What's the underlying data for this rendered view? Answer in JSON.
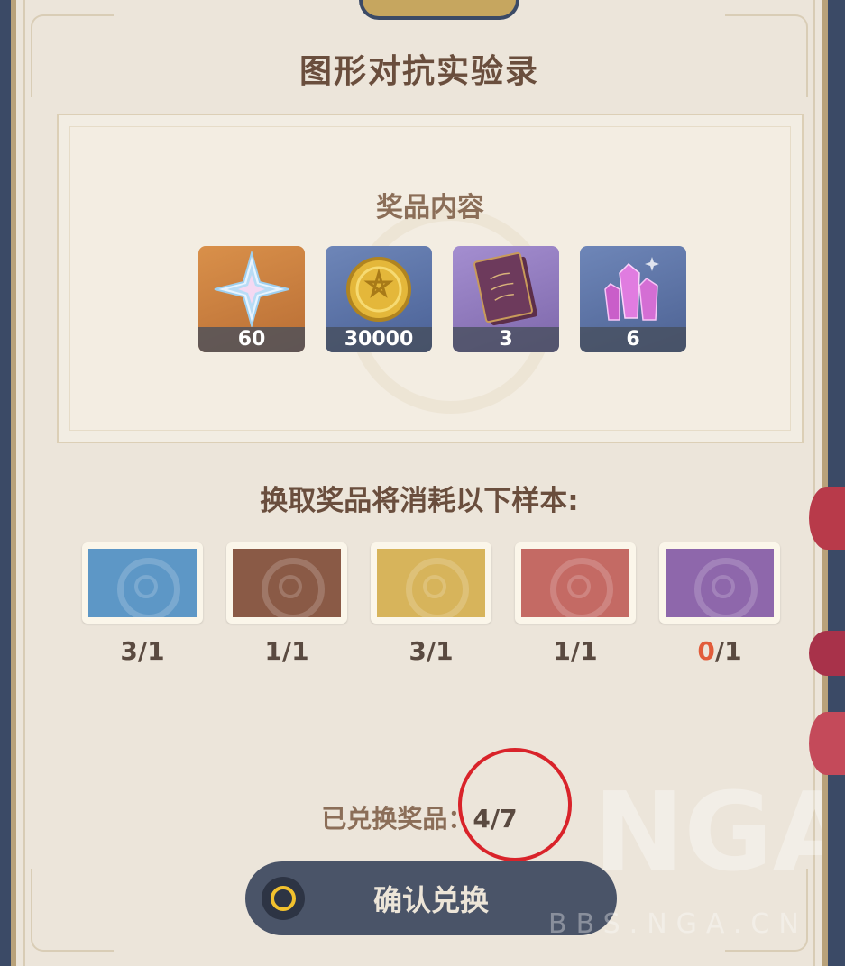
{
  "dialog": {
    "title": "图形对抗实验录",
    "reward_heading": "奖品内容",
    "consume_heading": "换取奖品将消耗以下样本:",
    "exchanged_label": "已兑换奖品：",
    "exchanged_value": "4/7",
    "confirm_label": "确认兑换"
  },
  "rewards": [
    {
      "icon": "primogem-icon",
      "count": "60"
    },
    {
      "icon": "mora-icon",
      "count": "30000"
    },
    {
      "icon": "book-icon",
      "count": "3"
    },
    {
      "icon": "crystal-icon",
      "count": "6"
    }
  ],
  "samples": [
    {
      "color": "#5d97c6",
      "have": "3",
      "need": "/1"
    },
    {
      "color": "#8a5a46",
      "have": "1",
      "need": "/1"
    },
    {
      "color": "#d7b45b",
      "have": "3",
      "need": "/1"
    },
    {
      "color": "#c46a64",
      "have": "1",
      "need": "/1"
    },
    {
      "color": "#8e67ab",
      "have": "0",
      "need": "/1"
    }
  ],
  "watermark": {
    "logo": "NGA",
    "text": "BBS.NGA.CN"
  }
}
